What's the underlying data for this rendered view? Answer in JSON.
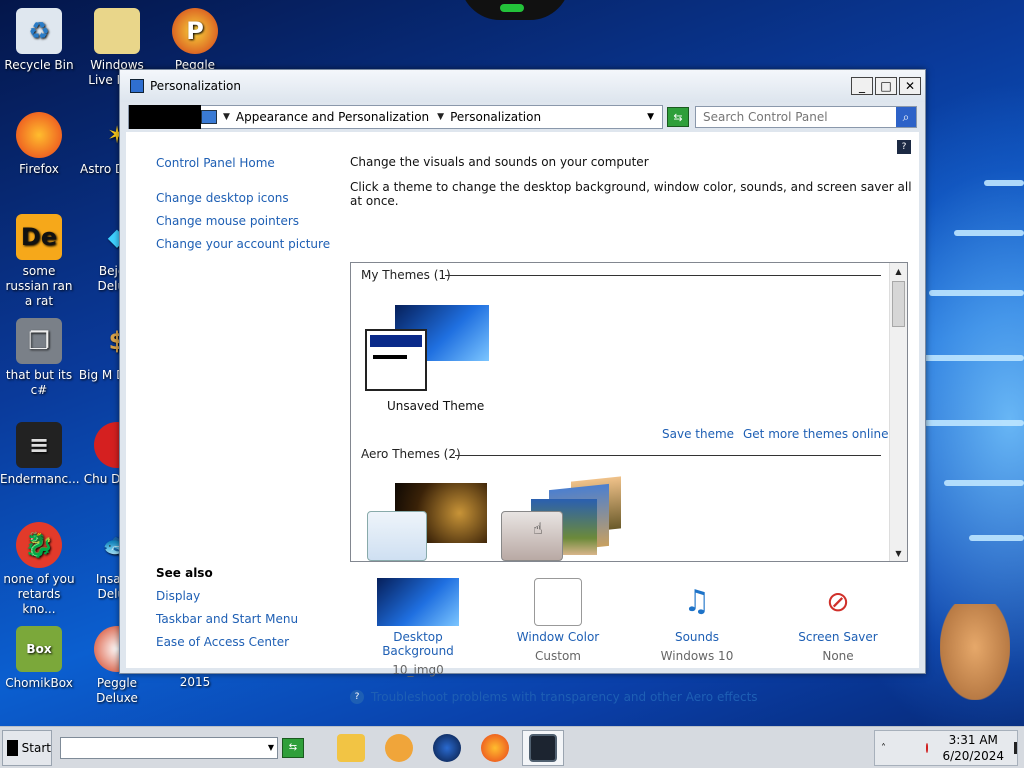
{
  "desktop": {
    "icons": [
      {
        "label": "Recycle Bin"
      },
      {
        "label": "Firefox"
      },
      {
        "label": "some russian ran a rat"
      },
      {
        "label": "that but its c#"
      },
      {
        "label": "Endermanc..."
      },
      {
        "label": "none of you retards kno..."
      },
      {
        "label": "ChomikBox"
      },
      {
        "label": "Windows Live Ma..."
      },
      {
        "label": "Peggle World"
      },
      {
        "label": "Astro Delu..."
      },
      {
        "label": "Bejew Delu..."
      },
      {
        "label": "Big M Delu..."
      },
      {
        "label": "Chu Delu..."
      },
      {
        "label": "Insanic Delu..."
      },
      {
        "label": "Peggle Deluxe"
      },
      {
        "label": "Visual Studio 2015"
      }
    ]
  },
  "window": {
    "title": "Personalization",
    "address": {
      "crumbs": [
        "Appearance and Personalization",
        "Personalization"
      ]
    },
    "search": {
      "placeholder": "Search Control Panel"
    },
    "left_pane": {
      "links": [
        "Control Panel Home",
        "Change desktop icons",
        "Change mouse pointers",
        "Change your account picture"
      ],
      "see_also_title": "See also",
      "see_also": [
        "Display",
        "Taskbar and Start Menu",
        "Ease of Access Center"
      ]
    },
    "main": {
      "heading": "Change the visuals and sounds on your computer",
      "instructions": "Click a theme to change the desktop background, window color, sounds, and screen saver all at once.",
      "groups": [
        {
          "title": "My Themes (1)"
        },
        {
          "title": "Aero Themes (2)"
        }
      ],
      "my_theme_label": "Unsaved Theme",
      "save_theme": "Save theme",
      "get_more": "Get more themes online"
    },
    "bottom": [
      {
        "label": "Desktop Background",
        "sub": "10_img0",
        "icon": "desktop-background-icon"
      },
      {
        "label": "Window Color",
        "sub": "Custom",
        "icon": "window-color-icon"
      },
      {
        "label": "Sounds",
        "sub": "Windows 10",
        "icon": "sounds-icon"
      },
      {
        "label": "Screen Saver",
        "sub": "None",
        "icon": "screen-saver-icon"
      }
    ],
    "troubleshoot": "Troubleshoot problems with transparency and other Aero effects"
  },
  "taskbar": {
    "start_label": "Start",
    "clock_time": "3:31 AM",
    "clock_date": "6/20/2024"
  },
  "colors": {
    "link": "#1e5fb4",
    "wallpaper": "#0b5fd0"
  }
}
